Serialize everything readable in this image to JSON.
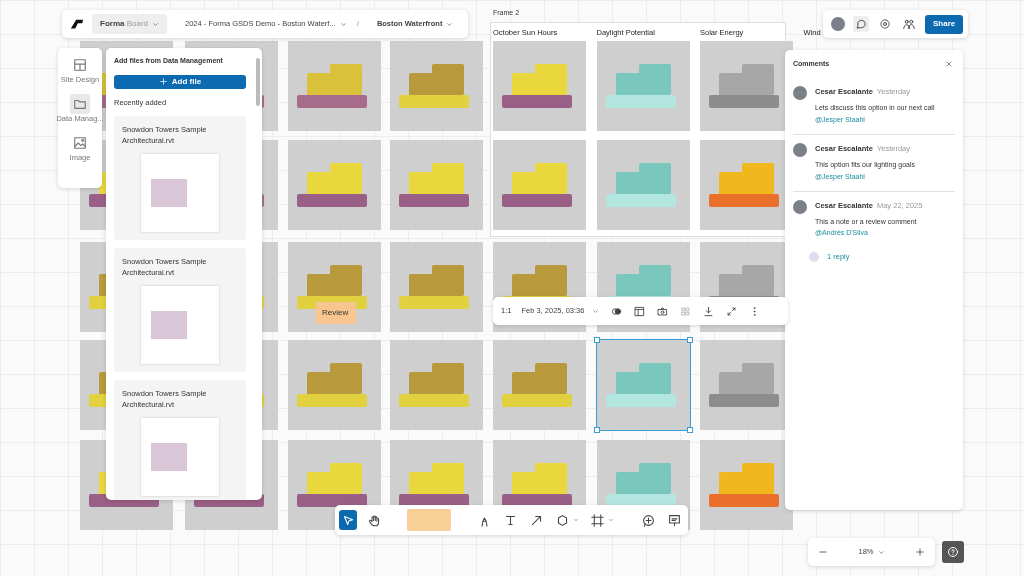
{
  "top_bar": {
    "brand": "Forma",
    "product": "Board",
    "breadcrumbs": [
      {
        "label": "2024 - Forma GSDS Demo - Boston Waterf..."
      },
      {
        "label": "Boston Waterfront"
      }
    ],
    "separator": "/"
  },
  "actions": {
    "share": "Share",
    "comments_open": true
  },
  "rail": [
    {
      "label": "Site Design",
      "selected": false
    },
    {
      "label": "Data Manag...",
      "selected": true
    },
    {
      "label": "Image",
      "selected": false
    }
  ],
  "files_panel": {
    "title": "Add files from Data Management",
    "add_button": "Add file",
    "section": "Recently added",
    "files": [
      {
        "name": "Snowdon Towers Sample Architectural.rvt"
      },
      {
        "name": "Snowdon Towers Sample Architectural.rvt"
      },
      {
        "name": "Snowdon Towers Sample Architectural.rvt"
      }
    ]
  },
  "canvas": {
    "frame_label": "Frame 2",
    "columns": [
      {
        "label": "October Sun Hours"
      },
      {
        "label": "Daylight Potential"
      },
      {
        "label": "Solar Energy"
      },
      {
        "label": "Wind"
      }
    ],
    "sticky_label": "Review"
  },
  "comments": {
    "title": "Comments",
    "items": [
      {
        "author": "Cesar Escalante",
        "time": "Yesterday",
        "text": "Lets discuss this option in our next call",
        "mention": "@Jesper Staahl"
      },
      {
        "author": "Cesar Escalante",
        "time": "Yesterday",
        "text": "This option fits our lighting goals",
        "mention": "@Jesper Staahl"
      },
      {
        "author": "Cesar Escalante",
        "time": "May 22, 2025",
        "text": "This a note or a review comment",
        "mention": "@Andrés D'Silva"
      }
    ],
    "replies": "1 reply"
  },
  "selection_toolbar": {
    "ratio": "1:1",
    "date": "Feb 3, 2025, 03:36"
  },
  "tools": [
    {
      "kind": "select",
      "selected": true
    },
    {
      "kind": "hand",
      "selected": false
    },
    {
      "kind": "sticky",
      "selected": false
    },
    {
      "kind": "pen",
      "selected": false
    },
    {
      "kind": "text",
      "selected": false
    },
    {
      "kind": "arrow",
      "selected": false
    },
    {
      "kind": "shape",
      "selected": false
    },
    {
      "kind": "frame",
      "selected": false
    },
    {
      "kind": "comment",
      "selected": false
    },
    {
      "kind": "present",
      "selected": false
    }
  ],
  "zoom": {
    "value": "18%"
  }
}
